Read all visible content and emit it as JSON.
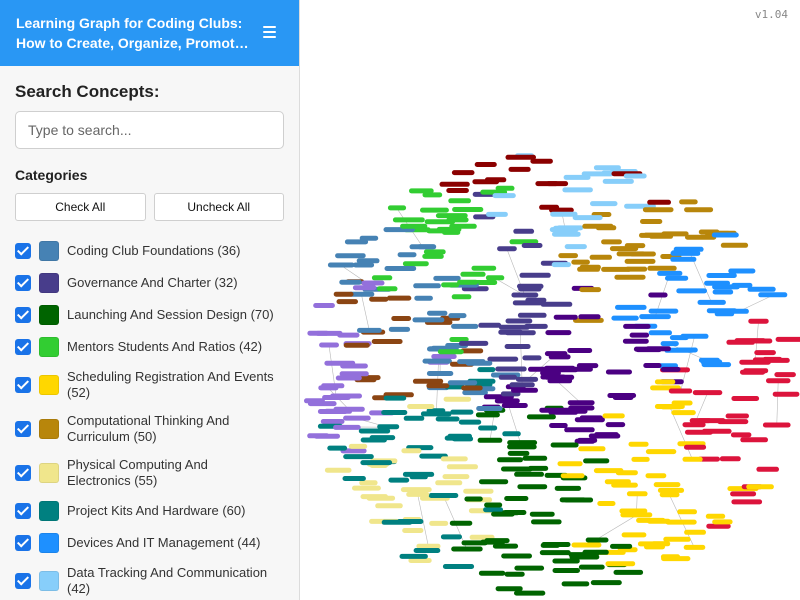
{
  "header": {
    "title_line1": "Learning Graph for Coding Clubs:",
    "title_line2": "How to Create, Organize, Promote and Sustain"
  },
  "search": {
    "title": "Search Concepts:",
    "placeholder": "Type to search..."
  },
  "categories": {
    "title": "Categories",
    "check_all": "Check All",
    "uncheck_all": "Uncheck All",
    "items": [
      {
        "label": "Coding Club Foundations (36)",
        "color": "#4682b4"
      },
      {
        "label": "Governance And Charter (32)",
        "color": "#483d8b"
      },
      {
        "label": "Launching And Session Design (70)",
        "color": "#006400"
      },
      {
        "label": "Mentors Students And Ratios (42)",
        "color": "#32cd32"
      },
      {
        "label": "Scheduling Registration And Events (52)",
        "color": "#ffd700"
      },
      {
        "label": "Computational Thinking And Curriculum (50)",
        "color": "#b8860b"
      },
      {
        "label": "Physical Computing And Electronics (55)",
        "color": "#f0e68c"
      },
      {
        "label": "Project Kits And Hardware (60)",
        "color": "#008080"
      },
      {
        "label": "Devices And IT Management (44)",
        "color": "#1e90ff"
      },
      {
        "label": "Data Tracking And Communication (42)",
        "color": "#87cefa"
      }
    ]
  },
  "graph": {
    "version": "v1.04",
    "extra_colors": [
      "#8b0000",
      "#8b4513",
      "#9370db",
      "#dc143c",
      "#4b0082"
    ]
  }
}
